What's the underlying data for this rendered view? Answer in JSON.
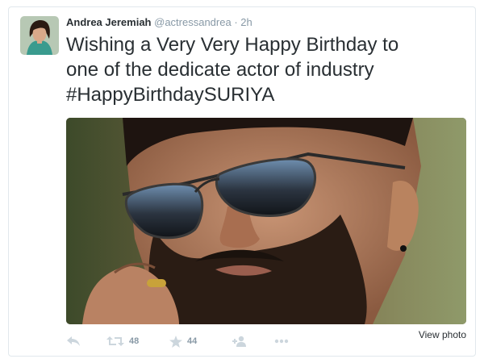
{
  "tweet": {
    "author_name": "Andrea Jeremiah",
    "handle": "@actressandrea",
    "separator": "·",
    "time": "2h",
    "text_lines": [
      "Wishing a Very Very Happy Birthday to",
      "one of the dedicate actor of industry",
      "#HappyBirthdaySURIYA"
    ]
  },
  "actions": {
    "retweet_count": "48",
    "favorite_count": "44",
    "view_photo_label": "View photo"
  },
  "colors": {
    "text": "#292f33",
    "muted": "#8899a6",
    "icon": "#ccd6dd",
    "border": "#e1e8ed"
  },
  "icons": [
    "reply-icon",
    "retweet-icon",
    "star-icon",
    "follow-icon",
    "more-icon"
  ]
}
